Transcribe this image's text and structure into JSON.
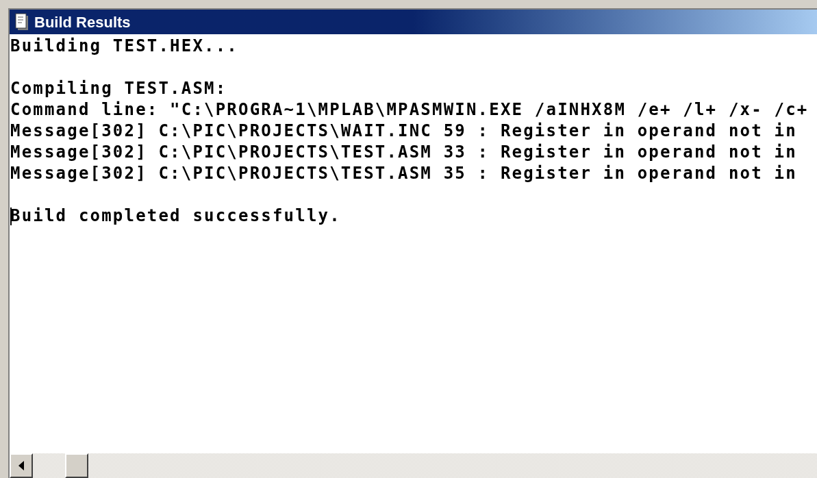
{
  "window": {
    "title": "Build Results"
  },
  "output_blocks": [
    {
      "lines": [
        "Building TEST.HEX..."
      ]
    },
    {
      "lines": [
        "Compiling TEST.ASM:",
        "Command line: \"C:\\PROGRA~1\\MPLAB\\MPASMWIN.EXE /aINHX8M /e+ /l+ /x- /c+",
        "Message[302] C:\\PIC\\PROJECTS\\WAIT.INC 59 : Register in operand not in",
        "Message[302] C:\\PIC\\PROJECTS\\TEST.ASM 33 : Register in operand not in",
        "Message[302] C:\\PIC\\PROJECTS\\TEST.ASM 35 : Register in operand not in"
      ]
    },
    {
      "lines": [
        "Build completed successfully."
      ],
      "cursor": true
    }
  ]
}
